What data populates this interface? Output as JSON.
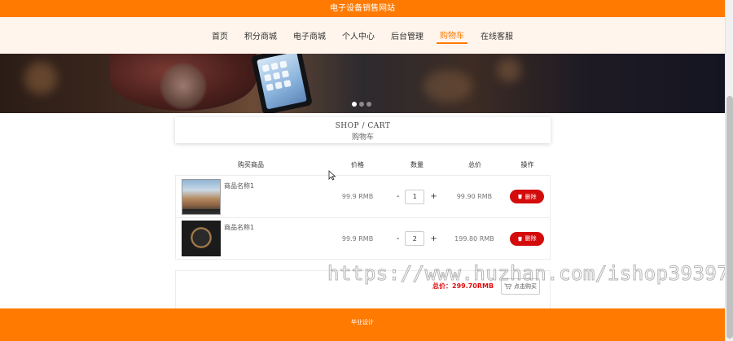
{
  "header": {
    "site_title": "电子设备销售网站"
  },
  "nav": {
    "items": [
      {
        "label": "首页"
      },
      {
        "label": "积分商城"
      },
      {
        "label": "电子商城"
      },
      {
        "label": "个人中心"
      },
      {
        "label": "后台管理"
      },
      {
        "label": "购物车"
      },
      {
        "label": "在线客服"
      }
    ],
    "active": "购物车"
  },
  "section": {
    "title_en": "SHOP / CART",
    "title_cn": "购物车"
  },
  "cart": {
    "columns": [
      "购买商品",
      "价格",
      "数量",
      "总价",
      "操作"
    ],
    "rows": [
      {
        "name": "商品名称1",
        "price": "99.9 RMB",
        "qty": "1",
        "qty_minus": "-",
        "qty_plus": "+",
        "total": "99.90 RMB",
        "delete_label": "删除",
        "thumb": "monitor-image"
      },
      {
        "name": "商品名称1",
        "price": "99.9 RMB",
        "qty": "2",
        "qty_minus": "-",
        "qty_plus": "+",
        "total": "199.80 RMB",
        "delete_label": "删除",
        "thumb": "watch-image"
      }
    ]
  },
  "summary": {
    "total_text": "总价：299.70RMB",
    "checkout_label": "点击购买"
  },
  "footer": {
    "text": "毕业设计"
  },
  "watermark": {
    "text": "https://www.huzhan.com/ishop39397"
  },
  "colors": {
    "accent": "#ff7a00",
    "danger": "#d30b0b",
    "nav_bg": "#fff5ec"
  }
}
